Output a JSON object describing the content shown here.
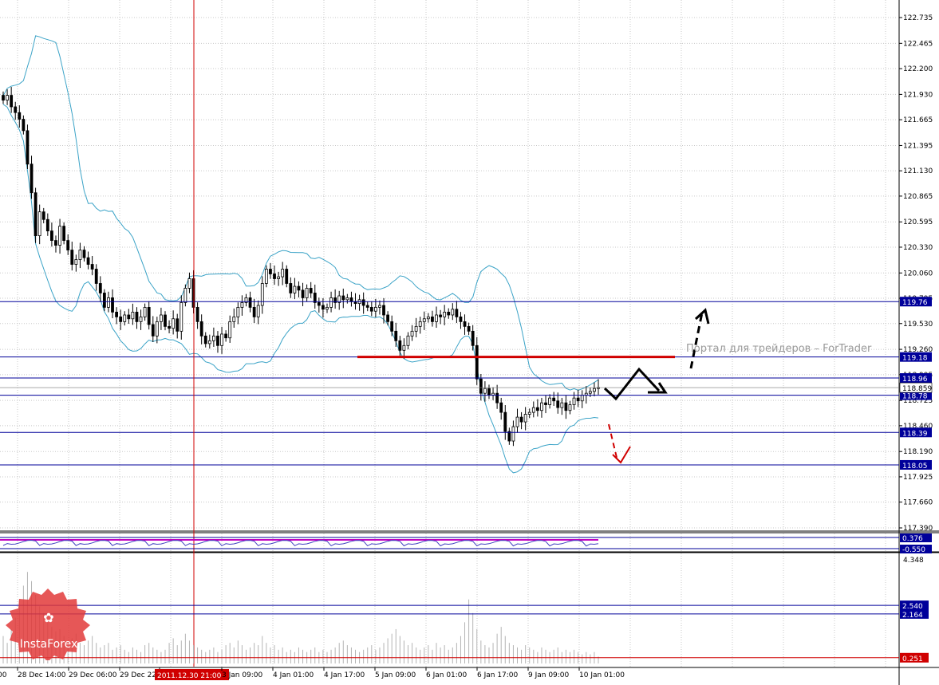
{
  "chart_data": {
    "type": "candlestick",
    "colors": {
      "background": "#ffffff",
      "grid": "#c8c8c8",
      "candle": "#000000",
      "bollinger": "#3ba3c7",
      "level_line": "#00009a",
      "current_price_line": "#d00000",
      "volume": "#b4b4b4",
      "oscillator": "#c000c0",
      "time_marker": "#d00000"
    },
    "price_axis": {
      "ticks": [
        "122.735",
        "122.465",
        "122.200",
        "121.930",
        "121.665",
        "121.395",
        "121.130",
        "120.865",
        "120.595",
        "120.330",
        "120.060",
        "119.795",
        "119.530",
        "119.260",
        "118.995",
        "118.725",
        "118.460",
        "118.190",
        "117.925",
        "117.660",
        "117.390"
      ],
      "range": [
        117.39,
        122.735
      ]
    },
    "levels": [
      {
        "label": "119.76",
        "value": 119.76
      },
      {
        "label": "119.18",
        "value": 119.18
      },
      {
        "label": "118.96",
        "value": 118.96
      },
      {
        "label": "118.78",
        "value": 118.78
      },
      {
        "label": "118.39",
        "value": 118.39
      },
      {
        "label": "118.05",
        "value": 118.05
      }
    ],
    "current_price": {
      "label": "118.859",
      "value": 118.859
    },
    "resistance_line": {
      "value": 119.18
    },
    "oscillator_axis": {
      "labels": [
        "0.376",
        "-0.550"
      ]
    },
    "volume_axis": {
      "ticks": [
        "4.348"
      ],
      "levels": [
        "2.540",
        "2.164",
        "0.251"
      ],
      "range": [
        0.0,
        4.6
      ]
    },
    "time_axis": {
      "labels": [
        "28 Dec 14:00",
        "29 Dec 06:00",
        "29 Dec 22:00",
        "2011.12.30 21:00",
        "3 Jan 09:00",
        "4 Jan 01:00",
        "4 Jan 17:00",
        "5 Jan 09:00",
        "6 Jan 01:00",
        "6 Jan 17:00",
        "9 Jan 09:00",
        "10 Jan 01:00"
      ],
      "highlighted": "2011.12.30 21:00",
      "clipped_left_label": ":00"
    },
    "price_path": [
      121.87,
      121.92,
      121.8,
      121.74,
      121.67,
      121.55,
      121.2,
      120.9,
      120.45,
      120.7,
      120.62,
      120.5,
      120.4,
      120.35,
      120.55,
      120.4,
      120.3,
      120.15,
      120.2,
      120.3,
      120.22,
      120.15,
      120.1,
      119.95,
      119.85,
      119.7,
      119.8,
      119.65,
      119.6,
      119.55,
      119.62,
      119.58,
      119.65,
      119.55,
      119.6,
      119.7,
      119.52,
      119.4,
      119.55,
      119.62,
      119.5,
      119.48,
      119.58,
      119.45,
      119.75,
      119.9,
      120.0,
      119.7,
      119.55,
      119.4,
      119.32,
      119.35,
      119.4,
      119.3,
      119.42,
      119.38,
      119.55,
      119.6,
      119.7,
      119.75,
      119.8,
      119.7,
      119.6,
      119.72,
      119.95,
      120.1,
      120.05,
      120.0,
      120.02,
      120.1,
      119.95,
      119.85,
      119.92,
      119.88,
      119.8,
      119.9,
      119.85,
      119.75,
      119.72,
      119.68,
      119.7,
      119.8,
      119.75,
      119.82,
      119.78,
      119.8,
      119.76,
      119.74,
      119.78,
      119.72,
      119.7,
      119.66,
      119.7,
      119.72,
      119.62,
      119.55,
      119.45,
      119.35,
      119.25,
      119.3,
      119.4,
      119.45,
      119.5,
      119.55,
      119.58,
      119.6,
      119.55,
      119.62,
      119.6,
      119.65,
      119.62,
      119.68,
      119.6,
      119.55,
      119.5,
      119.45,
      119.3,
      118.95,
      118.8,
      118.85,
      118.78,
      118.8,
      118.7,
      118.6,
      118.4,
      118.3,
      118.45,
      118.55,
      118.5,
      118.58,
      118.6,
      118.65,
      118.62,
      118.7,
      118.68,
      118.75,
      118.72,
      118.65,
      118.7,
      118.62,
      118.68,
      118.75,
      118.72,
      118.78,
      118.8,
      118.82,
      118.85,
      118.86
    ],
    "volumes": [
      1.2,
      0.9,
      1.5,
      2.0,
      2.8,
      3.4,
      4.0,
      3.6,
      3.0,
      2.5,
      2.2,
      1.8,
      1.6,
      1.4,
      1.5,
      1.2,
      1.0,
      1.1,
      1.3,
      0.9,
      0.8,
      1.0,
      1.2,
      0.9,
      0.7,
      0.8,
      0.9,
      0.6,
      0.7,
      0.8,
      0.6,
      0.5,
      0.7,
      0.6,
      0.5,
      0.8,
      0.9,
      0.7,
      0.6,
      0.5,
      0.6,
      0.9,
      1.1,
      0.8,
      1.0,
      1.3,
      1.0,
      0.8,
      0.7,
      0.6,
      0.5,
      0.6,
      0.7,
      0.5,
      0.6,
      0.8,
      0.9,
      0.7,
      1.0,
      0.8,
      0.6,
      0.7,
      0.9,
      0.8,
      1.2,
      0.9,
      0.7,
      0.8,
      0.6,
      0.7,
      0.5,
      0.6,
      0.5,
      0.7,
      0.6,
      0.5,
      0.6,
      0.7,
      0.5,
      0.6,
      0.5,
      0.6,
      0.7,
      0.9,
      1.0,
      0.8,
      0.7,
      0.6,
      0.5,
      0.6,
      0.7,
      0.8,
      0.6,
      0.7,
      0.9,
      1.1,
      1.3,
      1.5,
      1.2,
      1.0,
      0.8,
      0.9,
      0.7,
      0.6,
      0.7,
      0.8,
      0.6,
      0.9,
      0.7,
      0.8,
      0.6,
      0.7,
      0.9,
      1.2,
      1.8,
      2.8,
      2.2,
      1.5,
      1.0,
      0.8,
      0.7,
      0.9,
      1.3,
      1.6,
      1.2,
      0.9,
      0.8,
      0.7,
      0.6,
      0.8,
      0.7,
      0.6,
      0.5,
      0.7,
      0.6,
      0.5,
      0.6,
      0.7,
      0.5,
      0.6,
      0.5,
      0.6,
      0.5,
      0.4,
      0.5,
      0.4,
      0.5,
      0.3
    ]
  },
  "branding": {
    "logo_text": "InstaForex",
    "watermark": "Портал для трейдеров – ForTrader"
  }
}
